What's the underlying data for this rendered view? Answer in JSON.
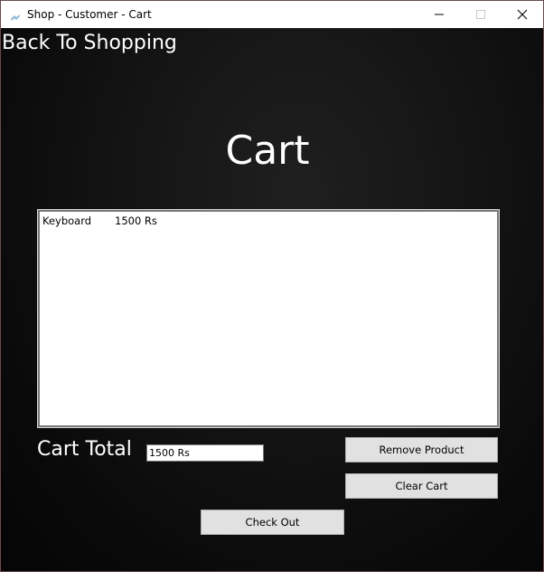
{
  "window": {
    "title": "Shop - Customer - Cart",
    "controls": {
      "minimize": "minimize-icon",
      "maximize": "maximize-icon",
      "close": "close-icon"
    }
  },
  "nav": {
    "back_label": "Back To Shopping"
  },
  "main": {
    "heading": "Cart",
    "cart_items": [
      {
        "name": "Keyboard",
        "price": "1500 Rs"
      }
    ],
    "total_label": "Cart Total",
    "total_value": "1500 Rs"
  },
  "actions": {
    "remove_label": "Remove Product",
    "clear_label": "Clear Cart",
    "checkout_label": "Check Out"
  },
  "colors": {
    "background": "#000000",
    "text_light": "#ffffff",
    "button_face": "#e1e1e1",
    "button_border": "#adadad"
  }
}
